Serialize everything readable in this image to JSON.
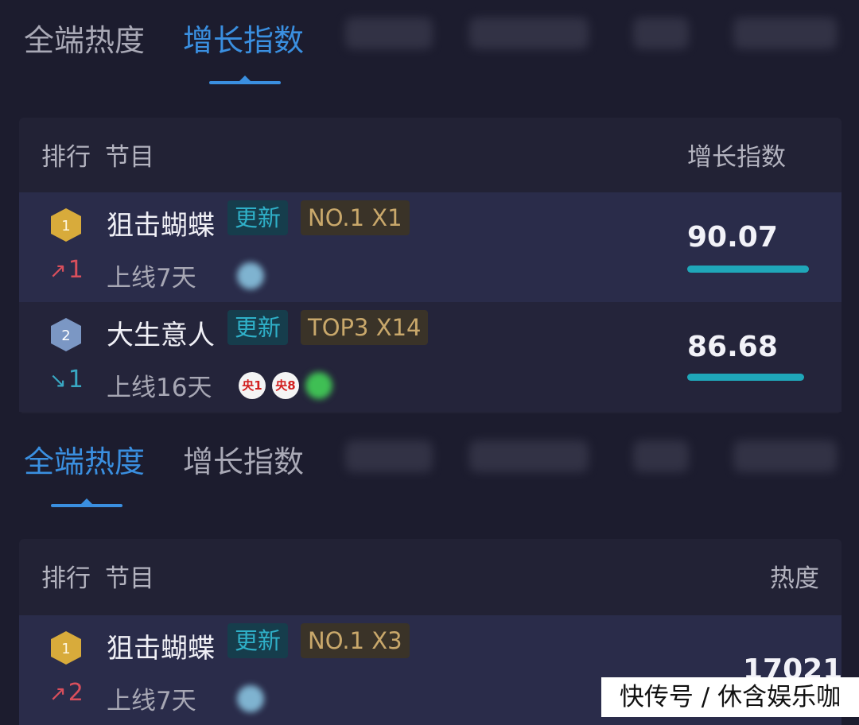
{
  "tabs": {
    "all_heat": "全端热度",
    "growth_index": "增长指数"
  },
  "growth_panel": {
    "header": {
      "rank": "排行",
      "program": "节目",
      "metric": "增长指数"
    },
    "rows": [
      {
        "rank": "1",
        "badge": "gold",
        "title": "狙击蝴蝶",
        "update_tag": "更新",
        "rank_tag": "NO.1 X1",
        "trend_dir": "up",
        "trend_value": "1",
        "online": "上线7天",
        "value": "90.07",
        "bar_fraction": 0.9007
      },
      {
        "rank": "2",
        "badge": "silver",
        "title": "大生意人",
        "update_tag": "更新",
        "rank_tag": "TOP3 X14",
        "trend_dir": "down",
        "trend_value": "1",
        "online": "上线16天",
        "channels": [
          "央1",
          "央8"
        ],
        "value": "86.68",
        "bar_fraction": 0.8668
      }
    ]
  },
  "heat_panel": {
    "header": {
      "rank": "排行",
      "program": "节目",
      "metric": "热度"
    },
    "rows": [
      {
        "rank": "1",
        "badge": "gold",
        "title": "狙击蝴蝶",
        "update_tag": "更新",
        "rank_tag": "NO.1 X3",
        "trend_dir": "up",
        "trend_value": "2",
        "online": "上线7天",
        "value": "17021"
      }
    ]
  },
  "watermark": "快传号 / 休含娱乐咖",
  "colors": {
    "background": "#1c1c2e",
    "accent": "#3a8fe0",
    "update_tag": "#2fb0c8",
    "rank_tag": "#c9a86b",
    "trend_up": "#d94f5c",
    "trend_down": "#39a8c3",
    "bar": "#1fa7b9",
    "gold_badge": "#d8ab3b",
    "silver_badge": "#7b97c4"
  }
}
